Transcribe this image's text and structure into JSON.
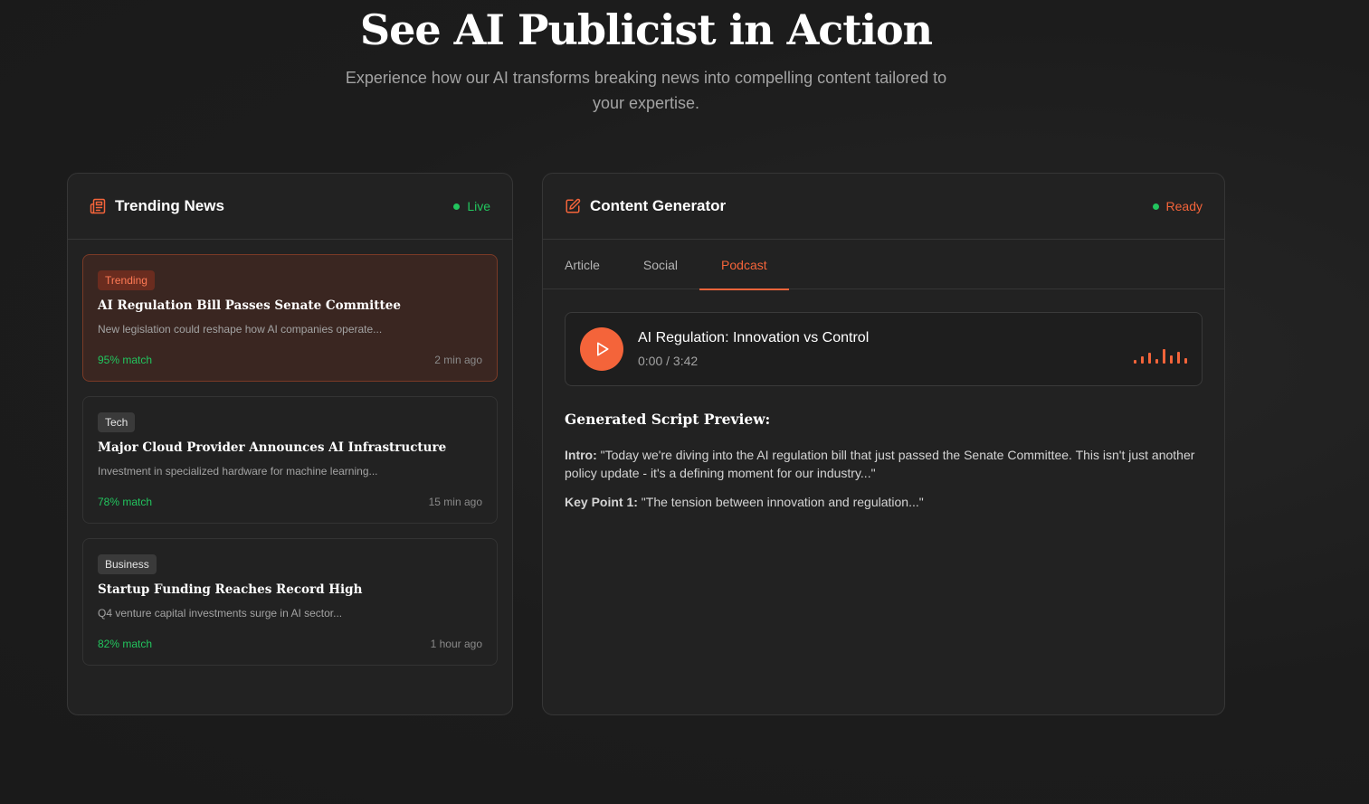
{
  "hero": {
    "title": "See AI Publicist in Action",
    "subtitle": "Experience how our AI transforms breaking news into compelling content tailored to your expertise."
  },
  "news_panel": {
    "title": "Trending News",
    "status": "Live",
    "items": [
      {
        "tag": "Trending",
        "title": "AI Regulation Bill Passes Senate Committee",
        "description": "New legislation could reshape how AI companies operate...",
        "match": "95% match",
        "time": "2 min ago"
      },
      {
        "tag": "Tech",
        "title": "Major Cloud Provider Announces AI Infrastructure",
        "description": "Investment in specialized hardware for machine learning...",
        "match": "78% match",
        "time": "15 min ago"
      },
      {
        "tag": "Business",
        "title": "Startup Funding Reaches Record High",
        "description": "Q4 venture capital investments surge in AI sector...",
        "match": "82% match",
        "time": "1 hour ago"
      }
    ]
  },
  "generator_panel": {
    "title": "Content Generator",
    "status": "Ready",
    "tabs": [
      "Article",
      "Social",
      "Podcast"
    ],
    "active_tab": "Podcast",
    "player": {
      "title": "AI Regulation: Innovation vs Control",
      "time": "0:00 / 3:42"
    },
    "script": {
      "heading": "Generated Script Preview:",
      "intro_label": "Intro:",
      "intro_text": " \"Today we're diving into the AI regulation bill that just passed the Senate Committee. This isn't just another policy update - it's a defining moment for our industry...\"",
      "key_label": "Key Point 1:",
      "key_text": " \"The tension between innovation and regulation...\""
    }
  },
  "colors": {
    "accent": "#f4643a",
    "live_green": "#22c55e",
    "background": "#1c1c1c",
    "panel": "#222222"
  }
}
